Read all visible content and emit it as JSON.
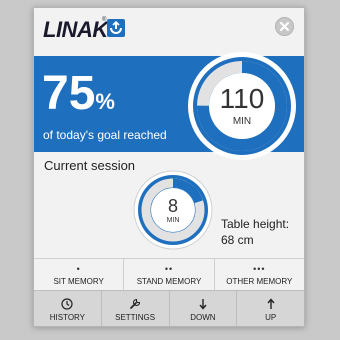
{
  "app": {
    "logo_text": "LINAK",
    "logo_sup": "®",
    "accent_color": "#1f6fbf"
  },
  "goal": {
    "percent_value": "75",
    "percent_sign": "%",
    "caption": "of today's goal reached",
    "progress_fraction": 0.75,
    "minutes": "110",
    "unit": "MIN"
  },
  "session": {
    "label": "Current session",
    "minutes": "8",
    "unit": "MIN",
    "progress_fraction": 0.2
  },
  "table": {
    "label": "Table height:",
    "value": "68 cm"
  },
  "memory": {
    "sit": {
      "dots": "•",
      "label": "SIT MEMORY"
    },
    "stand": {
      "dots": "••",
      "label": "STAND MEMORY"
    },
    "other": {
      "dots": "•••",
      "label": "OTHER MEMORY"
    }
  },
  "nav": {
    "history": {
      "label": "HISTORY",
      "icon": "clock-icon"
    },
    "settings": {
      "label": "SETTINGS",
      "icon": "wrench-icon"
    },
    "down": {
      "label": "DOWN",
      "icon": "arrow-down-icon"
    },
    "up": {
      "label": "UP",
      "icon": "arrow-up-icon"
    }
  }
}
